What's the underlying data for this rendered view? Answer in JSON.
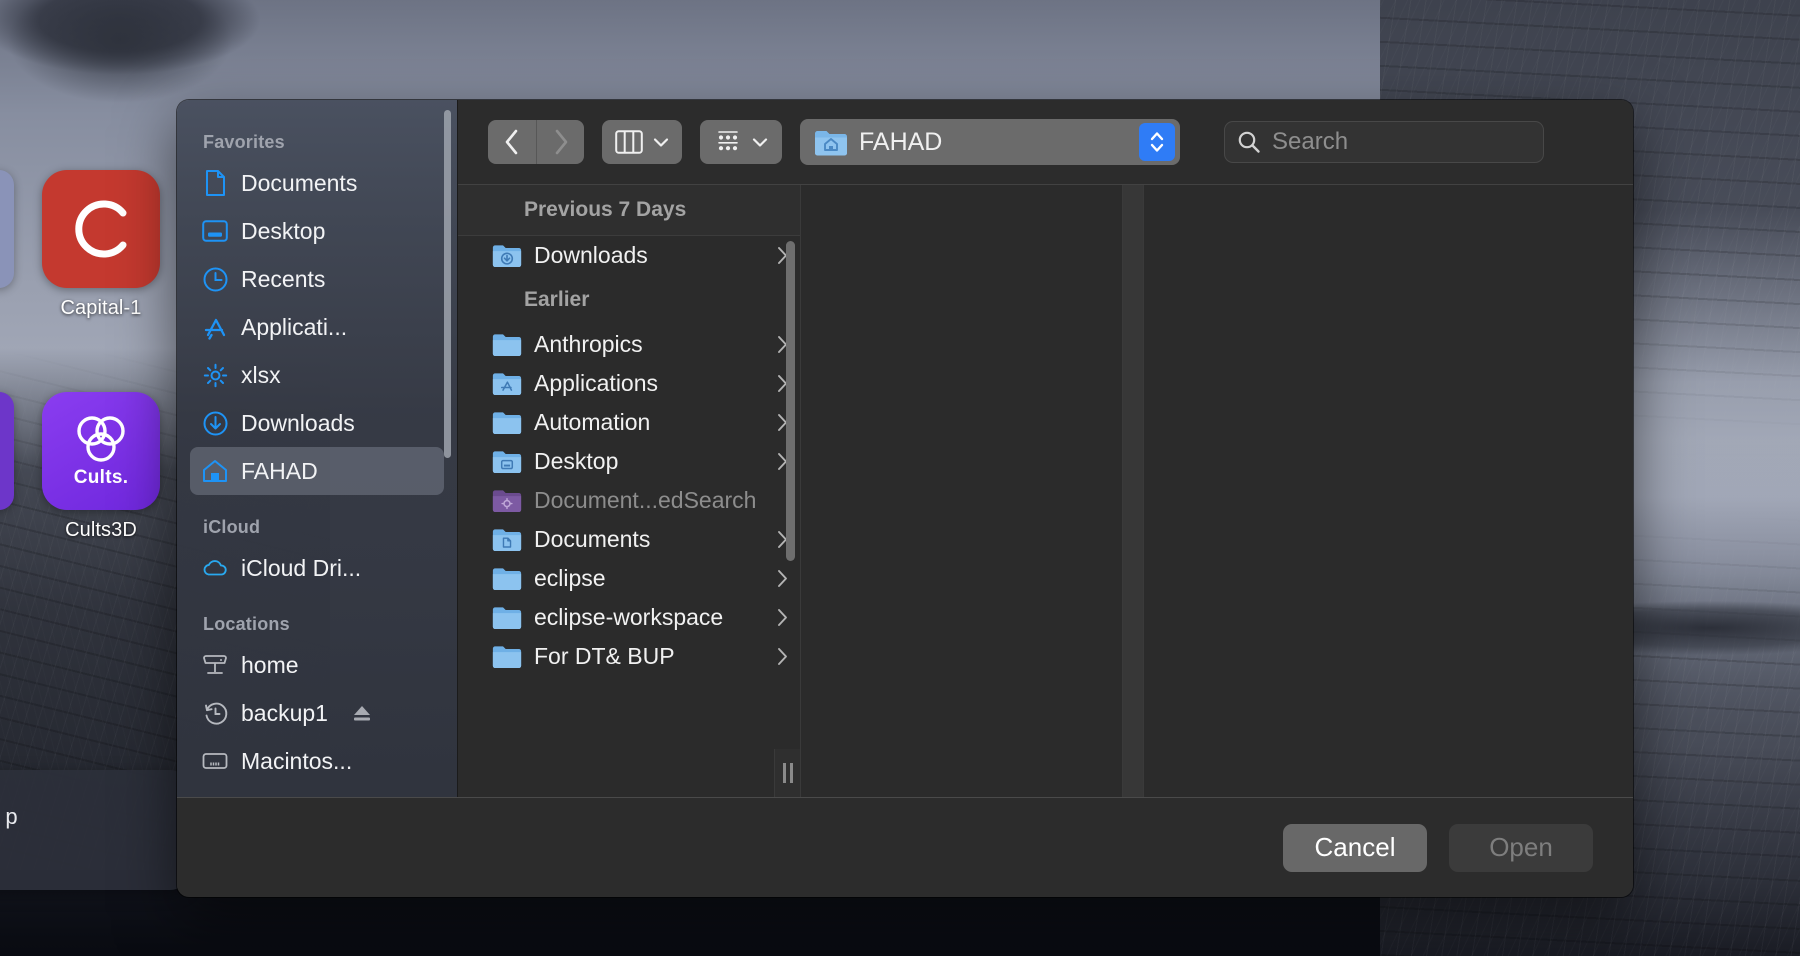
{
  "desktop": {
    "icons": [
      {
        "name": "Capital-1",
        "letter": "C",
        "color": "#c4392f",
        "kind": "letter"
      },
      {
        "name": "Cults3D",
        "letter": "Cults.",
        "color": "#7b35e8",
        "kind": "cults"
      }
    ],
    "notification_text": "ys, Safari has p"
  },
  "dialog": {
    "sidebar": {
      "sections": [
        {
          "header": "Favorites",
          "items": [
            {
              "label": "Documents",
              "icon": "document-icon",
              "selected": false,
              "eject": false
            },
            {
              "label": "Desktop",
              "icon": "desktop-icon",
              "selected": false,
              "eject": false
            },
            {
              "label": "Recents",
              "icon": "clock-icon",
              "selected": false,
              "eject": false
            },
            {
              "label": "Applicati...",
              "icon": "app-store-icon",
              "selected": false,
              "eject": false
            },
            {
              "label": "xlsx",
              "icon": "gear-icon",
              "selected": false,
              "eject": false
            },
            {
              "label": "Downloads",
              "icon": "download-icon",
              "selected": false,
              "eject": false
            },
            {
              "label": "FAHAD",
              "icon": "home-icon",
              "selected": true,
              "eject": false
            }
          ]
        },
        {
          "header": "iCloud",
          "items": [
            {
              "label": "iCloud Dri...",
              "icon": "cloud-icon",
              "selected": false,
              "eject": false
            }
          ]
        },
        {
          "header": "Locations",
          "items": [
            {
              "label": "home",
              "icon": "server-icon",
              "selected": false,
              "eject": false
            },
            {
              "label": "backup1",
              "icon": "time-machine-icon",
              "selected": false,
              "eject": true
            },
            {
              "label": "Macintos...",
              "icon": "hard-drive-icon",
              "selected": false,
              "eject": false
            }
          ]
        }
      ]
    },
    "toolbar": {
      "back_icon": "chevron-left-icon",
      "forward_icon": "chevron-right-icon",
      "view_icon": "column-view-icon",
      "view_chevron_icon": "chevron-down-icon",
      "group_icon": "group-by-icon",
      "group_chevron_icon": "chevron-down-icon",
      "path_label": "FAHAD",
      "path_folder_icon": "home-folder-icon",
      "path_stepper_icon": "stepper-up-down-icon",
      "search_icon": "search-icon",
      "search_value": "",
      "search_placeholder": "Search"
    },
    "columns": {
      "groups": [
        {
          "header": "Previous 7 Days",
          "items": [
            {
              "label": "Downloads",
              "icon": "downloads-folder-icon",
              "dim": false,
              "chevron": true
            }
          ]
        },
        {
          "header": "Earlier",
          "items": [
            {
              "label": "Anthropics",
              "icon": "folder-icon",
              "dim": false,
              "chevron": true
            },
            {
              "label": "Applications",
              "icon": "applications-folder-icon",
              "dim": false,
              "chevron": true
            },
            {
              "label": "Automation",
              "icon": "folder-icon",
              "dim": false,
              "chevron": true
            },
            {
              "label": "Desktop",
              "icon": "desktop-folder-icon",
              "dim": false,
              "chevron": true
            },
            {
              "label": "Document...edSearch",
              "icon": "smart-folder-icon",
              "dim": true,
              "chevron": false
            },
            {
              "label": "Documents",
              "icon": "documents-folder-icon",
              "dim": false,
              "chevron": true
            },
            {
              "label": "eclipse",
              "icon": "folder-icon",
              "dim": false,
              "chevron": true
            },
            {
              "label": "eclipse-workspace",
              "icon": "folder-icon",
              "dim": false,
              "chevron": true
            },
            {
              "label": "For DT& BUP",
              "icon": "folder-icon",
              "dim": false,
              "chevron": true
            }
          ]
        }
      ]
    },
    "footer": {
      "cancel_label": "Cancel",
      "open_label": "Open"
    }
  },
  "colors": {
    "accent_blue": "#2f7cf6",
    "sidebar_icon_blue": "#1e93f5",
    "folder_blue": "#5ba7e8",
    "selected_row": "#828996"
  }
}
